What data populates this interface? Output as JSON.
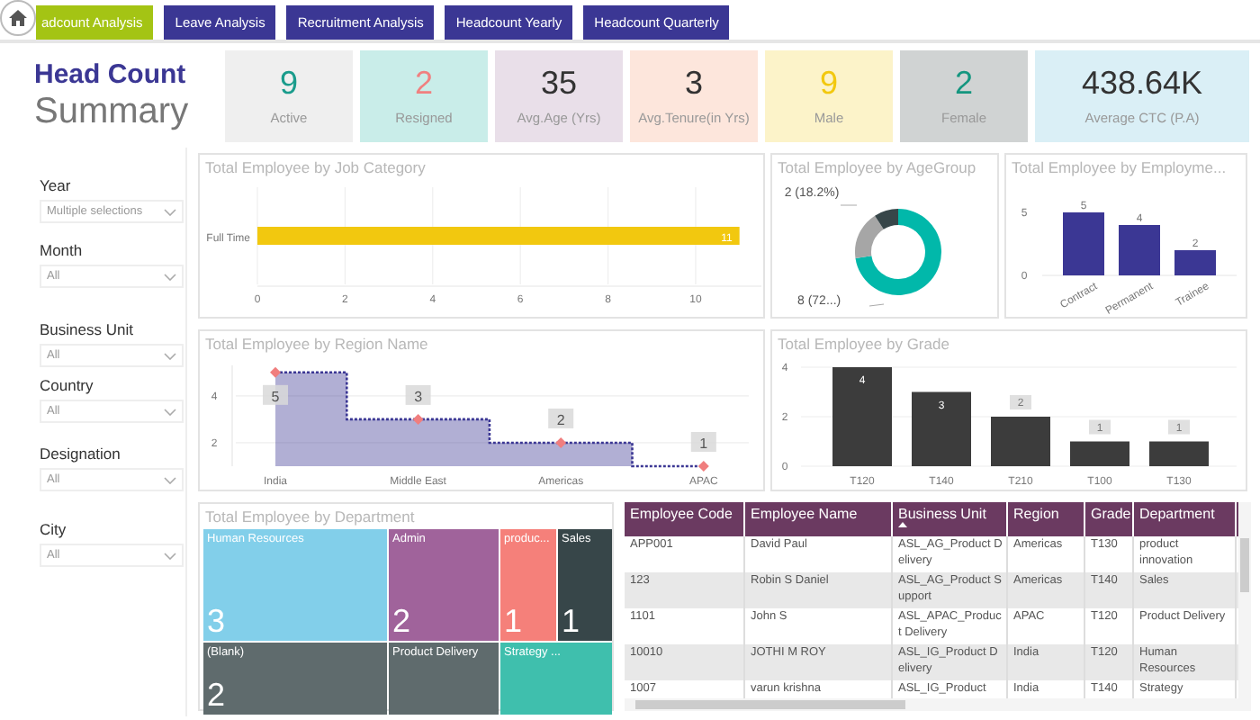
{
  "tabs": [
    {
      "label": "adcount Analysis",
      "selected": true
    },
    {
      "label": "Leave Analysis",
      "selected": false
    },
    {
      "label": "Recruitment Analysis",
      "selected": false
    },
    {
      "label": "Headcount Yearly",
      "selected": false
    },
    {
      "label": "Headcount Quarterly",
      "selected": false
    }
  ],
  "header": {
    "title": "Head Count",
    "subtitle": "Summary"
  },
  "kpis": [
    {
      "value": {
        "text": "9",
        "color": "#1a9c8c"
      },
      "label": "Active",
      "color": "#efefef"
    },
    {
      "value": {
        "text": "2",
        "color": "#f08080"
      },
      "label": "Resigned",
      "color": "#c9ede9"
    },
    {
      "value": {
        "text": "35",
        "color": "#333333"
      },
      "label": "Avg.Age (Yrs)",
      "color": "#e9dfe9"
    },
    {
      "value": {
        "text": "3",
        "color": "#333333"
      },
      "label": "Avg.Tenure(in Yrs)",
      "color": "#fde6dc"
    },
    {
      "value": {
        "text": "9",
        "color": "#f2c80f"
      },
      "label": "Male",
      "color": "#fcf3c9"
    },
    {
      "value": {
        "text": "2",
        "color": "#14967f"
      },
      "label": "Female",
      "color": "#d0d3d3"
    },
    {
      "value": {
        "text": "438.64K",
        "color": "#333333"
      },
      "label": "Average CTC (P.A)",
      "color": "#daeff6"
    }
  ],
  "filters": [
    {
      "label": "Year",
      "value": "Multiple selections"
    },
    {
      "label": "Month",
      "value": "All"
    },
    {
      "label": "Business Unit",
      "value": "All"
    },
    {
      "label": "Country",
      "value": "All"
    },
    {
      "label": "Designation",
      "value": "All"
    },
    {
      "label": "City",
      "value": "All"
    }
  ],
  "job_category": {
    "title": "Total Employee by Job Category",
    "chart_data": {
      "type": "bar",
      "orientation": "horizontal",
      "categories": [
        "Full Time"
      ],
      "series": [
        {
          "color": "#f2c80f",
          "values": [
            11
          ]
        }
      ],
      "xlim": [
        0,
        11.5
      ],
      "xticks": [
        0,
        2,
        4,
        6,
        8,
        10
      ],
      "grid": true,
      "data_labels": true
    }
  },
  "age_group": {
    "title": "Total Employee by AgeGroup",
    "chart_data": {
      "type": "donut",
      "series": [
        {
          "values": [
            72.7,
            18.2,
            9.1
          ]
        }
      ],
      "colors": [
        "#01b8aa",
        "#a6a6a6",
        "#374649"
      ],
      "value_labels": [
        "8 (72...)",
        "2 (18.2%)",
        null
      ]
    }
  },
  "employment": {
    "title": "Total Employee by Employme...",
    "chart_data": {
      "type": "bar",
      "categories": [
        "Contract",
        "Permanent",
        "Trainee"
      ],
      "series": [
        {
          "color": "#3b3794",
          "values": [
            5,
            4,
            2
          ]
        }
      ],
      "ylim": [
        0,
        5
      ],
      "yticks": [
        0,
        5
      ],
      "data_labels": true
    }
  },
  "region": {
    "title": "Total Employee by Region Name",
    "chart_data": {
      "type": "area",
      "categories": [
        "India",
        "Middle East",
        "Americas",
        "APAC"
      ],
      "series": [
        {
          "color": "#3b3794",
          "values": [
            5,
            3,
            2,
            1
          ]
        }
      ],
      "ylim": [
        1,
        5.3
      ],
      "yticks": [
        2,
        4
      ],
      "grid": true,
      "data_labels": true
    }
  },
  "grade": {
    "title": "Total Employee by Grade",
    "chart_data": {
      "type": "bar",
      "categories": [
        "T120",
        "T140",
        "T210",
        "T100",
        "T130"
      ],
      "series": [
        {
          "color": "#3c3c3c",
          "values": [
            4,
            3,
            2,
            1,
            1
          ]
        }
      ],
      "ylim": [
        0,
        4
      ],
      "yticks": [
        0,
        2,
        4
      ],
      "grid": true,
      "data_labels": true
    }
  },
  "department": {
    "title": "Total Employee by Department",
    "tiles": [
      {
        "label": "Human Resources",
        "count": "3",
        "color": "#82cfea"
      },
      {
        "label": "Admin",
        "count": "2",
        "color": "#a0639b"
      },
      {
        "label": "produc...",
        "count": "1",
        "color": "#f5807a"
      },
      {
        "label": "Sales",
        "count": "1",
        "color": "#374649"
      },
      {
        "label": "(Blank)",
        "count": "2",
        "color": "#5f6b6d"
      },
      {
        "label": "Product Delivery",
        "color": "#5f6b6d"
      },
      {
        "label": "Strategy ...",
        "color": "#3fbfad"
      }
    ]
  },
  "table": {
    "columns": [
      {
        "label": "Employee Code",
        "sorted": false
      },
      {
        "label": "Employee Name",
        "sorted": false
      },
      {
        "label": "Business Unit",
        "sorted": true
      },
      {
        "label": "Region",
        "sorted": false
      },
      {
        "label": "Grade",
        "sorted": false
      },
      {
        "label": "Department",
        "sorted": false
      }
    ],
    "rows": [
      [
        "APP001",
        "David Paul",
        "ASL_AG_Product Delivery",
        "Americas",
        "T130",
        "product innovation"
      ],
      [
        "123",
        "Robin S Daniel",
        "ASL_AG_Product Support",
        "Americas",
        "T140",
        "Sales"
      ],
      [
        "1101",
        "John S",
        "ASL_APAC_Product Delivery",
        "APAC",
        "T120",
        "Product Delivery"
      ],
      [
        "10010",
        "JOTHI M ROY",
        "ASL_IG_Product Delivery",
        "India",
        "T120",
        "Human Resources"
      ],
      [
        "1007",
        "varun krishna",
        "ASL_IG_Product",
        "India",
        "T140",
        "Strategy"
      ]
    ]
  }
}
